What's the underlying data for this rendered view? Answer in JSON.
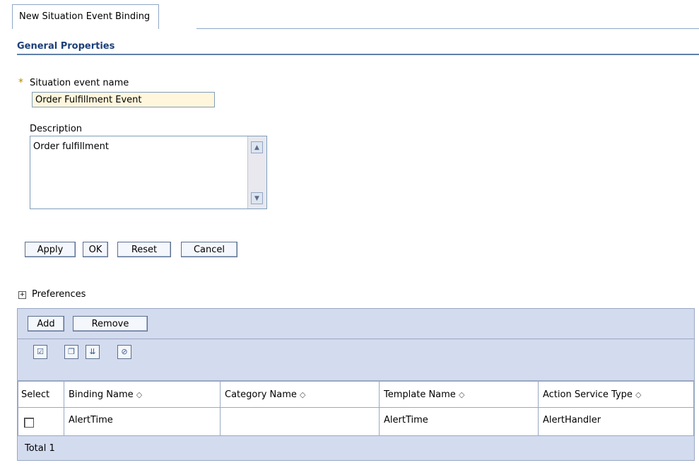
{
  "tab": {
    "title": "New Situation Event Binding"
  },
  "section": {
    "title": "General Properties"
  },
  "form": {
    "required_marker": "*",
    "name_label": "Situation event name",
    "name_value": "Order Fulfillment Event",
    "description_label": "Description",
    "description_value": "Order fulfillment"
  },
  "buttons": {
    "apply": "Apply",
    "ok": "OK",
    "reset": "Reset",
    "cancel": "Cancel"
  },
  "preferences": {
    "label": "Preferences",
    "icon": "expand-plus-icon"
  },
  "collection": {
    "add": "Add",
    "remove": "Remove",
    "icons": [
      "select-all-icon",
      "deselect-all-icon",
      "show-filter-icon",
      "clear-filter-icon"
    ],
    "columns": [
      "Select",
      "Binding Name",
      "Category Name",
      "Template Name",
      "Action Service Type"
    ],
    "sort_glyph": "◇",
    "rows": [
      {
        "select": false,
        "binding_name": "AlertTime",
        "category_name": "",
        "template_name": "AlertTime",
        "action_service_type": "AlertHandler"
      }
    ],
    "total": "Total 1"
  }
}
